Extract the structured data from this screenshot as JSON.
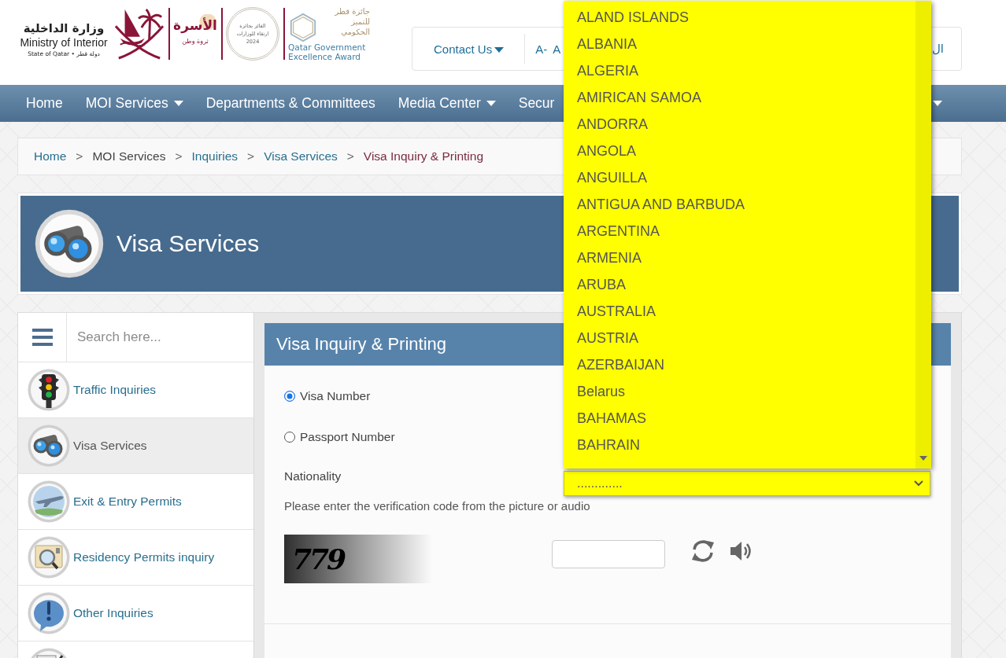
{
  "header": {
    "ministry_logo": {
      "arabic_name": "وزارة الداخلية",
      "english_name": "Ministry of Interior",
      "state_line": "State of Qatar • دولة قطر"
    },
    "family_logo": {
      "title": "الأسرة",
      "slogan": "ثروة وطن"
    },
    "award_seal": {
      "lines": [
        "الفائز بجائزة",
        "ارتقاء للوزارات",
        "2024"
      ]
    },
    "award_logo": {
      "arabic_lines": [
        "جائزة قطر",
        "للتميز",
        "الحكومي"
      ],
      "english_lines": [
        "Qatar Government",
        "Excellence Award"
      ]
    }
  },
  "top_bar": {
    "contact": {
      "label": "Contact Us",
      "has_menu": true
    },
    "font_smaller": "A-",
    "font_larger": "A",
    "language": "ال"
  },
  "nav": {
    "items": [
      {
        "label": "Home",
        "has_menu": false
      },
      {
        "label": "MOI Services",
        "has_menu": true
      },
      {
        "label": "Departments & Committees",
        "has_menu": false
      },
      {
        "label": "Media Center",
        "has_menu": true
      },
      {
        "label": "Secur",
        "has_menu": false
      }
    ],
    "overflow_caret": true
  },
  "breadcrumb": [
    {
      "label": "Home",
      "kind": "link"
    },
    {
      "label": "MOI Services",
      "kind": "plain",
      "separator": ">"
    },
    {
      "label": "Inquiries",
      "kind": "link",
      "separator": ">"
    },
    {
      "label": "Visa Services",
      "kind": "link",
      "separator": ">"
    },
    {
      "label": "Visa Inquiry & Printing",
      "kind": "current",
      "separator": ">"
    }
  ],
  "banner": {
    "title": "Visa Services"
  },
  "sidebar": {
    "search": {
      "placeholder": "Search here..."
    },
    "items": [
      {
        "label": "Traffic Inquiries",
        "kind": "traffic",
        "selected": false
      },
      {
        "label": "Visa Services",
        "kind": "visa",
        "selected": true
      },
      {
        "label": "Exit & Entry Permits",
        "kind": "travel",
        "selected": false
      },
      {
        "label": "Residency Permits inquiry",
        "kind": "residency",
        "selected": false
      },
      {
        "label": "Other Inquiries",
        "kind": "other",
        "selected": false
      },
      {
        "kind": "document",
        "selected": false
      }
    ]
  },
  "panel": {
    "title": "Visa Inquiry & Printing",
    "search_by": [
      {
        "label": "Visa Number",
        "selected": true
      },
      {
        "label": "Passport Number",
        "selected": false
      }
    ],
    "nationality": {
      "label": "Nationality",
      "value": ".............",
      "open": true,
      "options": [
        {
          "label": "ALAND ISLANDS",
          "selected": false
        },
        {
          "label": "ALBANIA",
          "selected": false
        },
        {
          "label": "ALGERIA",
          "selected": false
        },
        {
          "label": "AMIRICAN SAMOA",
          "selected": false
        },
        {
          "label": "ANDORRA",
          "selected": false
        },
        {
          "label": "ANGOLA",
          "selected": false
        },
        {
          "label": "ANGUILLA",
          "selected": false
        },
        {
          "label": "ANTIGUA AND BARBUDA",
          "selected": false
        },
        {
          "label": "ARGENTINA",
          "selected": false
        },
        {
          "label": "ARMENIA",
          "selected": false
        },
        {
          "label": "ARUBA",
          "selected": false
        },
        {
          "label": "AUSTRALIA",
          "selected": false
        },
        {
          "label": "AUSTRIA",
          "selected": false
        },
        {
          "label": "AZERBAIJAN",
          "selected": false
        },
        {
          "label": "Belarus",
          "selected": false
        },
        {
          "label": "BAHAMAS",
          "selected": false
        },
        {
          "label": "BAHRAIN",
          "selected": false
        }
      ]
    },
    "captcha": {
      "instruction": "Please enter the verification code from the picture or audio",
      "code": "779"
    }
  }
}
